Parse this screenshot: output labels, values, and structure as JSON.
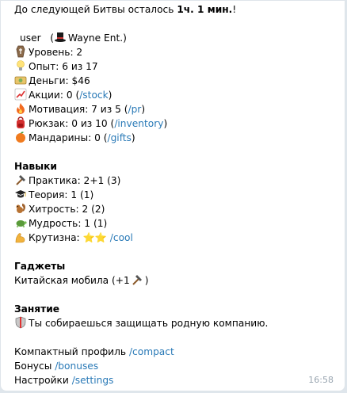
{
  "header": {
    "prefix": "До следующей Битвы осталось ",
    "time_bold": "1ч. 1 мин.",
    "suffix": "!"
  },
  "profile": {
    "name": "user",
    "org_open": "(",
    "org": "Wayne Ent.)",
    "org_icon": "top-hat-icon"
  },
  "stats": [
    {
      "icon": "coffin-icon",
      "label": "Уровень: 2",
      "link": ""
    },
    {
      "icon": "lightbulb-icon",
      "label": "Опыт: 6 из 17",
      "link": ""
    },
    {
      "icon": "money-icon",
      "label": "Деньги: $46",
      "link": ""
    },
    {
      "icon": "chart-up-icon",
      "label": "Акции: 0 (",
      "link": "/stock",
      "tail": ")"
    },
    {
      "icon": "fire-icon",
      "label": "Мотивация: 7 из 5 (",
      "link": "/pr",
      "tail": ")"
    },
    {
      "icon": "backpack-icon",
      "label": "Рюкзак: 0 из 10 (",
      "link": "/inventory",
      "tail": ")"
    },
    {
      "icon": "tangerine-icon",
      "label": "Мандарины: 0 (",
      "link": "/gifts",
      "tail": ")"
    }
  ],
  "skills": {
    "title": "Навыки",
    "items": [
      {
        "icon": "hammer-icon",
        "label": "Практика: 2+1 (3)"
      },
      {
        "icon": "graduation-cap-icon",
        "label": "Теория: 1 (1)"
      },
      {
        "icon": "squirrel-icon",
        "label": "Хитрость: 2 (2)"
      },
      {
        "icon": "turtle-icon",
        "label": "Мудрость: 1 (1)"
      },
      {
        "icon": "flexed-biceps-icon",
        "label": "Крутизна: ",
        "stars": "⭐⭐",
        "link": "/cool"
      }
    ]
  },
  "gadgets": {
    "title": "Гаджеты",
    "item": "Китайская мобила (+1",
    "item_tail": ")"
  },
  "occupation": {
    "title": "Занятие",
    "text": "Ты собираешься защищать родную компанию."
  },
  "links": [
    {
      "label": "Компактный профиль ",
      "link": "/compact"
    },
    {
      "label": "Бонусы ",
      "link": "/bonuses"
    },
    {
      "label": "Настройки ",
      "link": "/settings"
    }
  ],
  "timestamp": "16:58",
  "colors": {
    "link": "#2a7ab7",
    "background": "#dfe6ec",
    "bubble": "#ffffff",
    "timestamp": "#9aa6b1"
  }
}
